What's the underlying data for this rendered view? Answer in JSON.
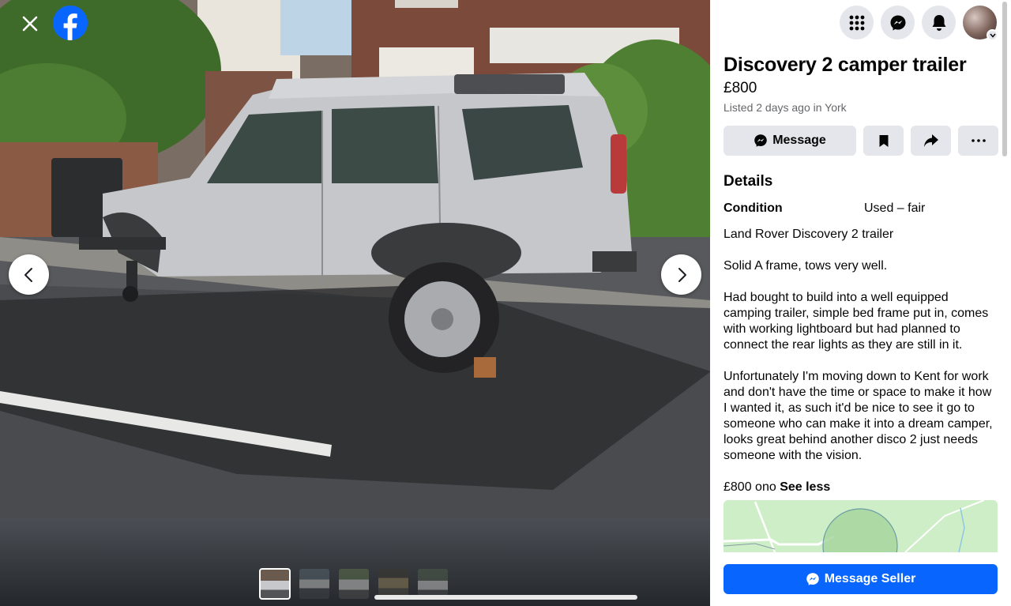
{
  "viewer": {
    "close_icon": "close-icon",
    "logo_icon": "facebook-logo-icon",
    "prev_icon": "chevron-left-icon",
    "next_icon": "chevron-right-icon",
    "thumbnails": [
      {
        "name": "thumbnail-1",
        "active": true
      },
      {
        "name": "thumbnail-2",
        "active": false
      },
      {
        "name": "thumbnail-3",
        "active": false
      },
      {
        "name": "thumbnail-4",
        "active": false
      },
      {
        "name": "thumbnail-5",
        "active": false
      }
    ]
  },
  "top_bar": {
    "icons": [
      "menu-grid-icon",
      "messenger-icon",
      "notifications-bell-icon",
      "account-avatar"
    ]
  },
  "listing": {
    "title": "Discovery 2 camper trailer",
    "price": "£800",
    "listed": "Listed 2 days ago in York",
    "message_label": "Message",
    "details_heading": "Details",
    "condition_label": "Condition",
    "condition_value": "Used – fair",
    "description": "Land Rover Discovery 2 trailer\n\nSolid A frame, tows very well.\n\nHad bought to build into a well equipped camping trailer, simple bed frame put in, comes with working lightboard but had planned to connect the rear lights as they are still in it.\n\nUnfortunately I'm moving down to Kent for work and don't have the time or space to make it how I wanted it, as such it'd be nice to see it go to someone who can make it into a dream camper, looks great behind another disco 2 just needs someone with the vision.",
    "price_note": "£800 ono",
    "see_less": "See less",
    "message_seller": "Message Seller"
  },
  "colors": {
    "brand_blue": "#0866ff",
    "button_grey": "#e4e6eb",
    "secondary_text": "#65676b"
  }
}
